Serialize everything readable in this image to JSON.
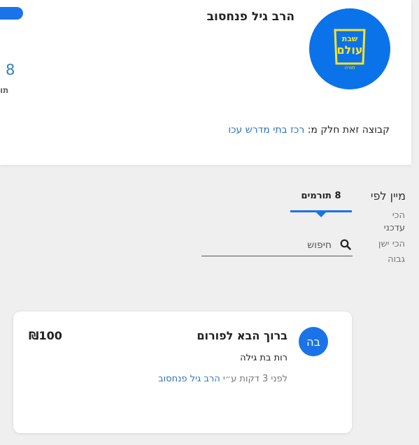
{
  "header": {
    "org_name": "הרב גיל פנחסוב",
    "side_count": "8",
    "side_label": "תו",
    "group_prefix": "קבוצה זאת חלק מ:",
    "group_link": "רכז בתי מדרש עכו",
    "logo_text_top": "שבת",
    "logo_text_main": "עולם",
    "logo_text_bottom": "תורה"
  },
  "sort": {
    "title": "מיין לפי",
    "options": [
      "הכי",
      "עדכני",
      "הכי ישן",
      "גבוה"
    ]
  },
  "tabs": [
    {
      "label": "8 תורמים",
      "active": true
    }
  ],
  "search": {
    "placeholder": "חיפוש",
    "value": ""
  },
  "donations": [
    {
      "initials": "בה",
      "title": "ברוך הבא לפורום",
      "amount": "₪100",
      "donor": "רות בת גילה",
      "time_prefix": "לפני 3 דקות ע״י",
      "by": "הרב גיל פנחסוב"
    }
  ],
  "colors": {
    "accent": "#1a73e8",
    "link": "#2f74c0",
    "logo_bg": "#0a73ea",
    "logo_fg": "#f7e229"
  }
}
